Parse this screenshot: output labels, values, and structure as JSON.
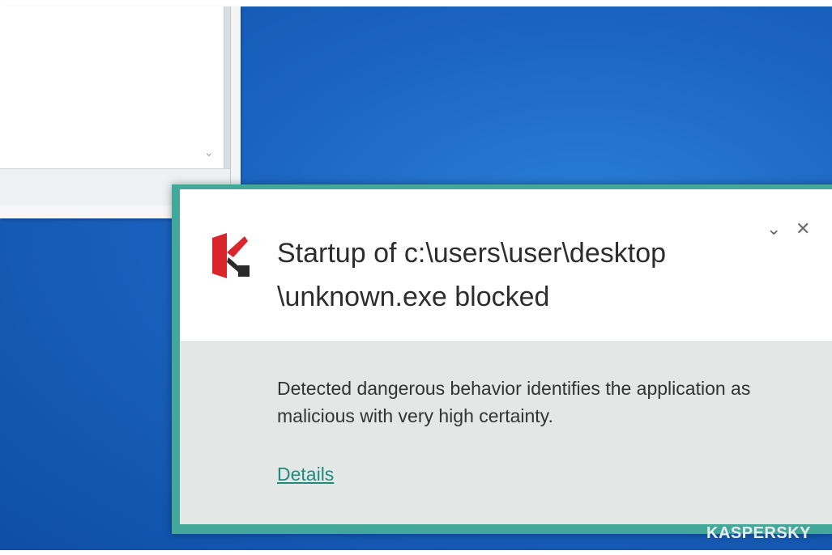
{
  "notification": {
    "title_line1": "Startup of c:\\users\\user\\desktop",
    "title_line2": "\\unknown.exe blocked",
    "description": "Detected dangerous behavior identifies the application as malicious with very high certainty.",
    "details_link": "Details",
    "collapse_glyph": "⌄",
    "close_glyph": "✕",
    "brand": "KASPERSKY"
  },
  "background_window": {
    "scroll_glyph": "⌄"
  },
  "colors": {
    "frame": "#43a89a",
    "link": "#1f8a7e",
    "logo_red": "#d9262d",
    "desktop": "#1a63bf"
  },
  "icons": {
    "app_logo": "kaspersky-logo-icon",
    "collapse": "chevron-down-icon",
    "close": "close-icon"
  }
}
